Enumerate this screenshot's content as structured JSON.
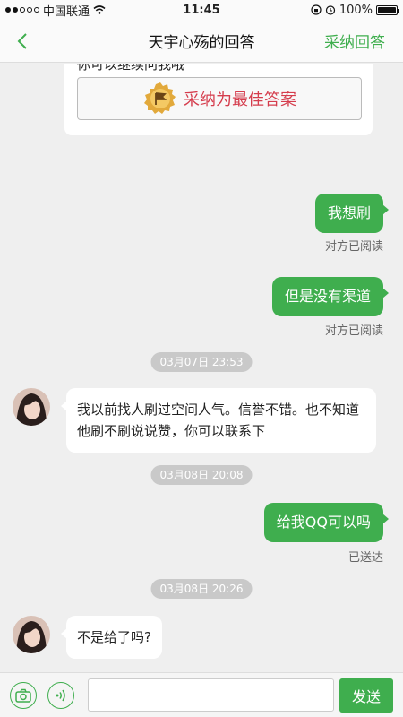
{
  "status_bar": {
    "carrier": "中国联通",
    "time": "11:45",
    "battery": "100%",
    "battery_level": 1.0
  },
  "nav": {
    "title": "天宇心殇的回答",
    "accept_label": "采纳回答"
  },
  "answer_card": {
    "text": "你可以继续问我哦",
    "best_answer_label": "采纳为最佳答案"
  },
  "messages": {
    "m1": {
      "text": "我想刷",
      "status": "对方已阅读"
    },
    "m2": {
      "text": "但是没有渠道",
      "status": "对方已阅读"
    },
    "ts1": "03月07日 23:53",
    "m3": {
      "text": "我以前找人刷过空间人气。信誉不错。也不知道他刷不刷说说赞，你可以联系下"
    },
    "ts2": "03月08日 20:08",
    "m4": {
      "text": "给我QQ可以吗",
      "status": "已送达"
    },
    "ts3": "03月08日 20:26",
    "m5": {
      "text": "不是给了吗?"
    }
  },
  "input_bar": {
    "send_label": "发送",
    "input_value": ""
  },
  "colors": {
    "accent": "#3fae4e",
    "best_answer": "#d53d4d",
    "background": "#efefef"
  }
}
